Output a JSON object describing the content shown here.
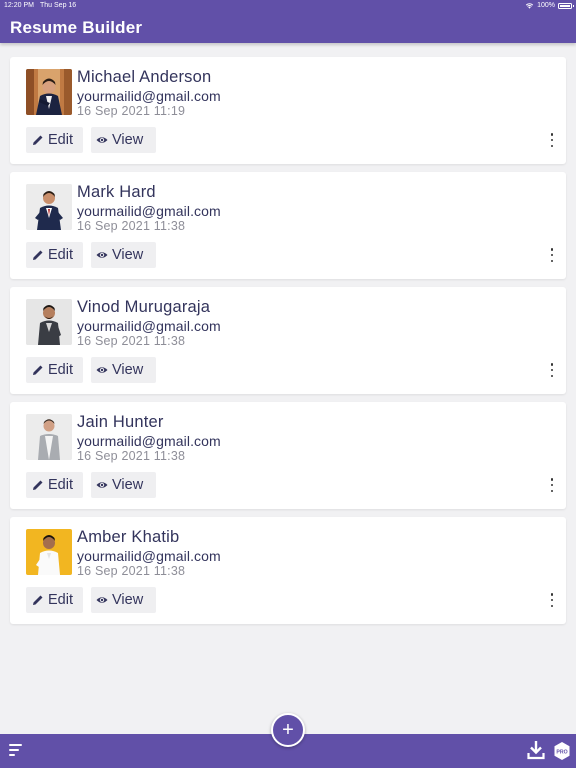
{
  "status_bar": {
    "time": "12:20 PM",
    "date": "Thu Sep 16",
    "battery": "100%",
    "wifi_icon": "wifi-icon",
    "battery_icon": "battery-icon"
  },
  "header": {
    "title": "Resume Builder"
  },
  "resumes": [
    {
      "name": "Michael Anderson",
      "email": "yourmailid@gmail.com",
      "date": "16 Sep 2021 11:19"
    },
    {
      "name": "Mark Hard",
      "email": "yourmailid@gmail.com",
      "date": "16 Sep 2021 11:38"
    },
    {
      "name": "Vinod Murugaraja",
      "email": "yourmailid@gmail.com",
      "date": "16 Sep 2021 11:38"
    },
    {
      "name": "Jain Hunter",
      "email": "yourmailid@gmail.com",
      "date": "16 Sep 2021 11:38"
    },
    {
      "name": "Amber Khatib",
      "email": "yourmailid@gmail.com",
      "date": "16 Sep 2021 11:38"
    }
  ],
  "actions": {
    "edit_label": "Edit",
    "view_label": "View",
    "edit_icon": "pencil-icon",
    "view_icon": "eye-icon",
    "more_icon": "more-vertical-icon"
  },
  "bottom_bar": {
    "menu_icon": "sort-menu-icon",
    "add_label": "+",
    "download_icon": "download-icon",
    "pro_label": "PRO"
  },
  "colors": {
    "primary": "#6150a8",
    "text_dark": "#33345c",
    "text_muted": "#8e8e98",
    "background": "#f1f1f3"
  }
}
